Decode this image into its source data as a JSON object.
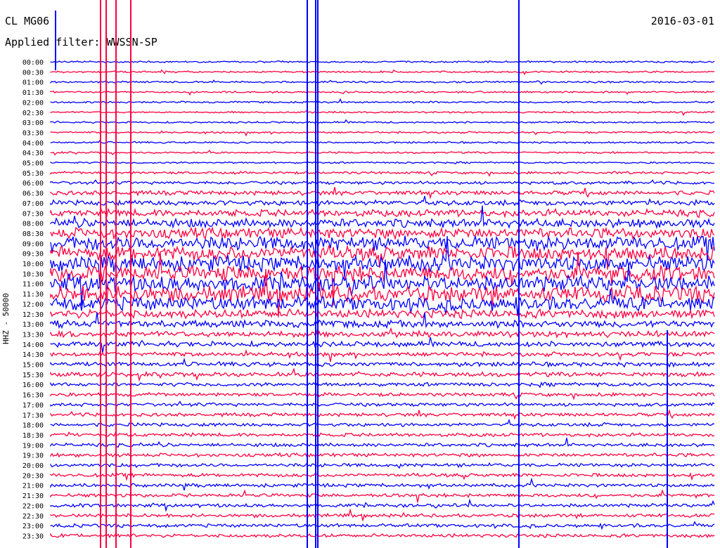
{
  "header": {
    "station": "CL MG06",
    "date": "2016-03-01",
    "filter": "Applied filter: WWSSN-SP"
  },
  "chart_data": {
    "type": "line",
    "title": "CL MG06",
    "ylabel": "HHZ - 50000",
    "rows": [
      "00:00",
      "00:30",
      "01:00",
      "01:30",
      "02:00",
      "02:30",
      "03:00",
      "03:30",
      "04:00",
      "04:30",
      "05:00",
      "05:30",
      "06:00",
      "06:30",
      "07:00",
      "07:30",
      "08:00",
      "08:30",
      "09:00",
      "09:30",
      "10:00",
      "10:30",
      "11:00",
      "11:30",
      "12:00",
      "12:30",
      "13:00",
      "13:30",
      "14:00",
      "14:30",
      "15:00",
      "15:30",
      "16:00",
      "16:30",
      "17:00",
      "17:30",
      "18:00",
      "18:30",
      "19:00",
      "19:30",
      "20:00",
      "20:30",
      "21:00",
      "21:30",
      "22:00",
      "22:30",
      "23:00",
      "23:30"
    ],
    "colors": [
      "#0000ff",
      "#ff0040"
    ],
    "amplitude": [
      1,
      1,
      1,
      1,
      1,
      1,
      1,
      1,
      1,
      1,
      1,
      1.4,
      1.8,
      2.5,
      3,
      4,
      5,
      6,
      8,
      8,
      9,
      9,
      9,
      9,
      8,
      5,
      4,
      3.5,
      3,
      2.5,
      2.5,
      2.5,
      2.2,
      2,
      2,
      2,
      2,
      2,
      2,
      2,
      2,
      2,
      2,
      2,
      2,
      2,
      2,
      2
    ]
  }
}
